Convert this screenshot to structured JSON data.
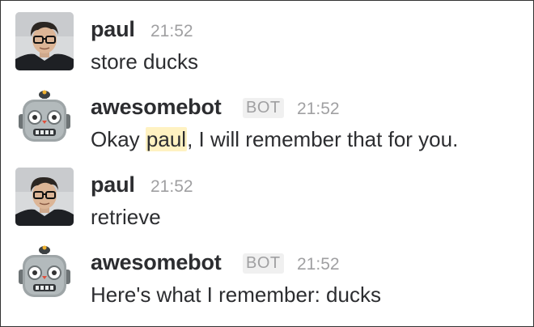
{
  "colors": {
    "text": "#2c2d30",
    "muted": "#a0a0a2",
    "mention_highlight": "#fff2c2",
    "border": "#333333"
  },
  "messages": [
    {
      "author": "paul",
      "time": "21:52",
      "text": "store ducks",
      "avatar": "person-avatar"
    },
    {
      "author": "awesomebot",
      "badge": "BOT",
      "time": "21:52",
      "text_before": "Okay ",
      "mention": "paul",
      "text_after": ", I will remember that for you.",
      "avatar": "robot-avatar"
    },
    {
      "author": "paul",
      "time": "21:52",
      "text": "retrieve",
      "avatar": "person-avatar"
    },
    {
      "author": "awesomebot",
      "badge": "BOT",
      "time": "21:52",
      "text": "Here's what I remember: ducks",
      "avatar": "robot-avatar"
    }
  ]
}
